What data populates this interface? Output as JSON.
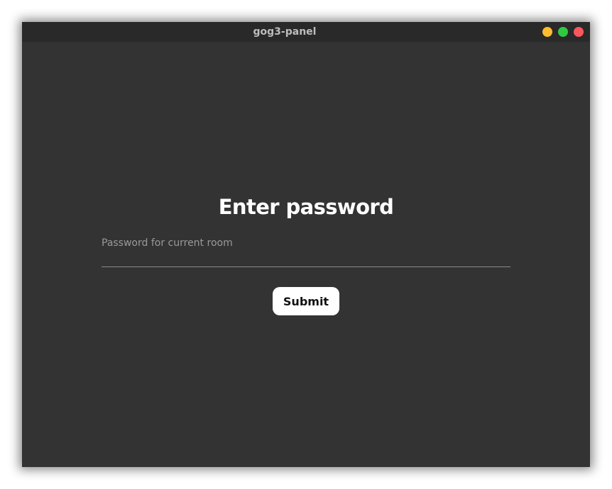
{
  "window": {
    "title": "gog3-panel",
    "controls": [
      {
        "name": "minimize",
        "color": "#fdbc2e"
      },
      {
        "name": "maximize",
        "color": "#2fca43"
      },
      {
        "name": "close",
        "color": "#fb565d"
      }
    ]
  },
  "form": {
    "heading": "Enter password",
    "password": {
      "placeholder": "Password for current room",
      "value": ""
    },
    "submit_label": "Submit"
  },
  "colors": {
    "background": "#333333",
    "titlebar": "#292929",
    "button_bg": "#ffffff"
  }
}
